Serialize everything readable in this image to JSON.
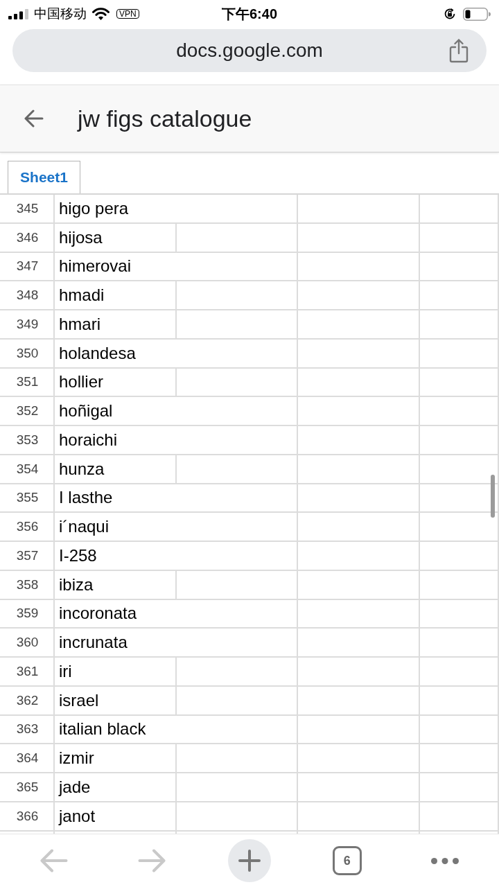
{
  "status_bar": {
    "carrier": "中国移动",
    "vpn": "VPN",
    "time": "下午6:40"
  },
  "address_bar": {
    "url": "docs.google.com"
  },
  "doc_header": {
    "title": "jw figs catalogue"
  },
  "sheet_tabs": [
    {
      "label": "Sheet1",
      "selected": true
    }
  ],
  "grid": {
    "rows": [
      {
        "number": "345",
        "name": "higo pera",
        "spans": true
      },
      {
        "number": "346",
        "name": "hijosa",
        "spans": false
      },
      {
        "number": "347",
        "name": "himerovai",
        "spans": true
      },
      {
        "number": "348",
        "name": "hmadi",
        "spans": false
      },
      {
        "number": "349",
        "name": "hmari",
        "spans": false
      },
      {
        "number": "350",
        "name": "holandesa",
        "spans": true
      },
      {
        "number": "351",
        "name": "hollier",
        "spans": false
      },
      {
        "number": "352",
        "name": "hoñigal",
        "spans": true
      },
      {
        "number": "353",
        "name": "horaichi",
        "spans": true
      },
      {
        "number": "354",
        "name": "hunza",
        "spans": false
      },
      {
        "number": "355",
        "name": "I lasthe",
        "spans": true
      },
      {
        "number": "356",
        "name": "i´naqui",
        "spans": true
      },
      {
        "number": "357",
        "name": "I-258",
        "spans": true
      },
      {
        "number": "358",
        "name": "ibiza",
        "spans": false
      },
      {
        "number": "359",
        "name": "incoronata",
        "spans": true
      },
      {
        "number": "360",
        "name": "incrunata",
        "spans": true
      },
      {
        "number": "361",
        "name": "iri",
        "spans": false
      },
      {
        "number": "362",
        "name": "israel",
        "spans": false
      },
      {
        "number": "363",
        "name": "italian black",
        "spans": true
      },
      {
        "number": "364",
        "name": "izmir",
        "spans": false
      },
      {
        "number": "365",
        "name": "jade",
        "spans": false
      },
      {
        "number": "366",
        "name": "janot",
        "spans": false
      }
    ]
  },
  "toolbar": {
    "buttons": [
      {
        "kind": "back",
        "disabled": true
      },
      {
        "kind": "forward",
        "disabled": true
      },
      {
        "kind": "new_tab",
        "disabled": false
      },
      {
        "kind": "tab_switcher",
        "label": "6",
        "disabled": false
      },
      {
        "kind": "more",
        "disabled": false
      }
    ]
  }
}
